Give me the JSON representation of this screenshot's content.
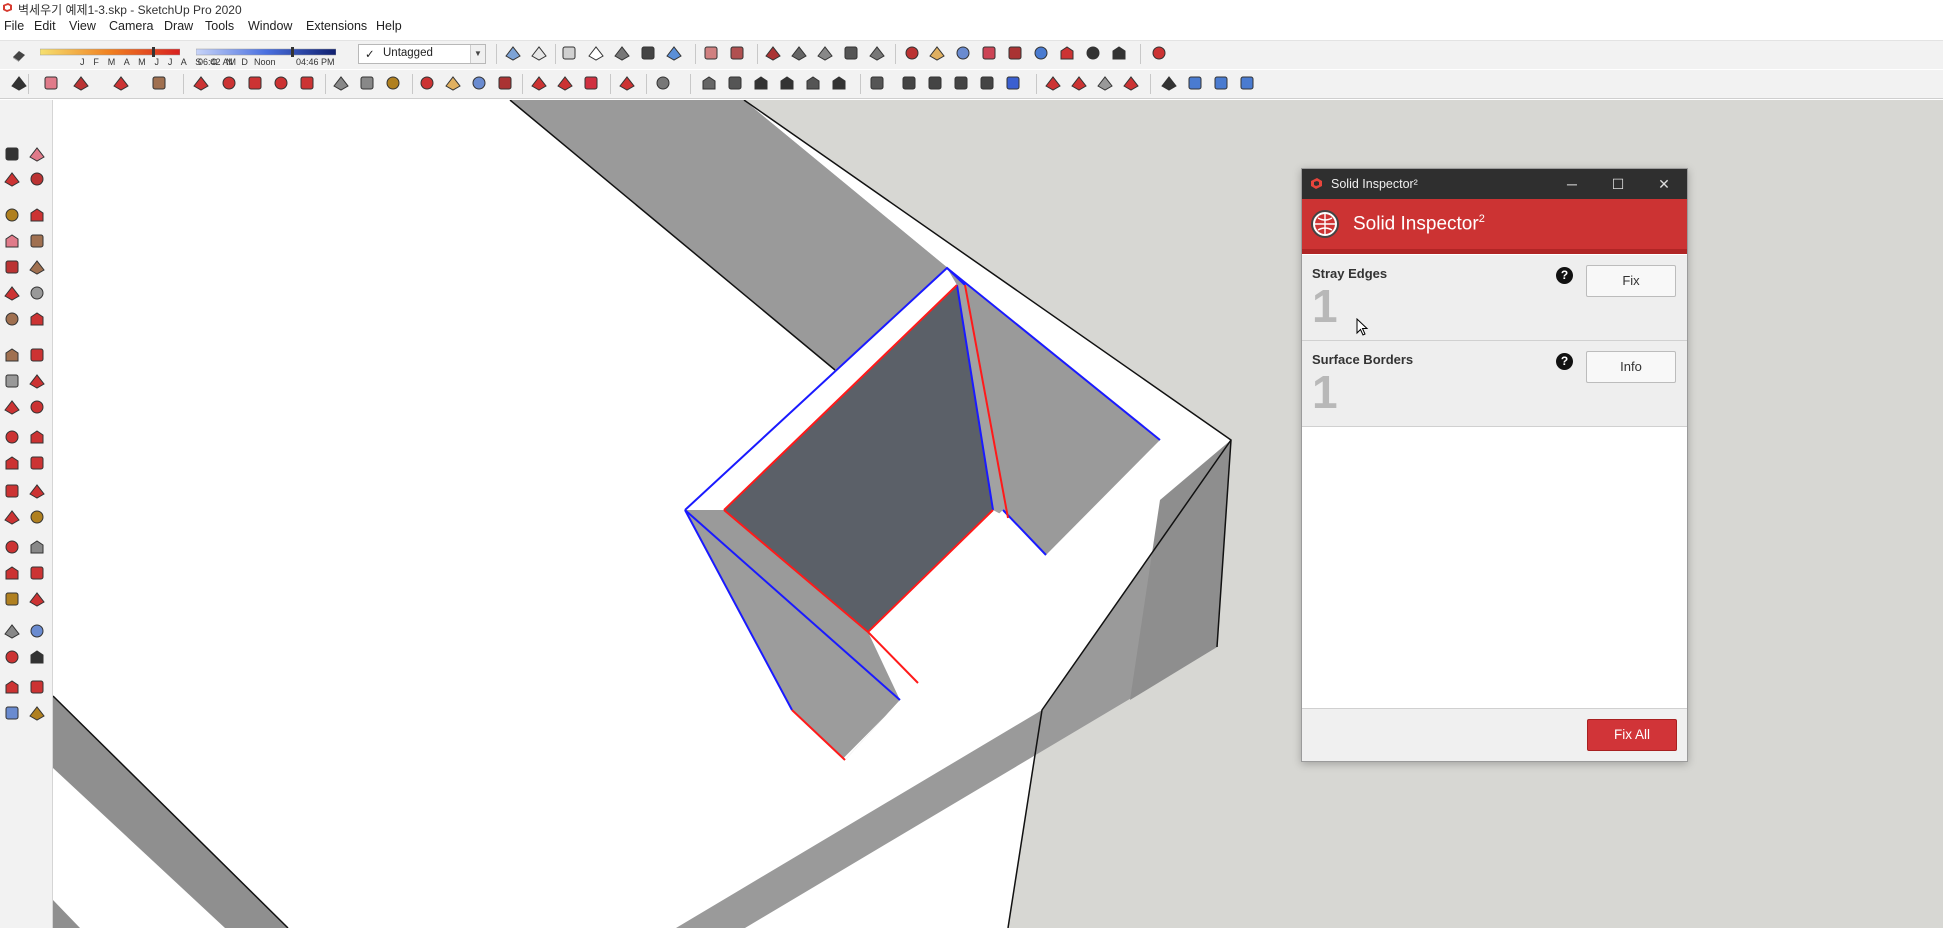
{
  "window": {
    "title": "벽세우기 예제1-3.skp - SketchUp Pro 2020"
  },
  "menubar": {
    "items": [
      "File",
      "Edit",
      "View",
      "Camera",
      "Draw",
      "Tools",
      "Window",
      "Extensions",
      "Help"
    ]
  },
  "shadow_settings": {
    "months": "J F M A M J J A S O N D",
    "time_start": "06:42 AM",
    "time_mid": "Noon",
    "time_end": "04:46 PM"
  },
  "tag_selector": {
    "value": "Untagged",
    "check": "✓"
  },
  "solid_inspector": {
    "window_title": "Solid Inspector²",
    "header_title": "Solid Inspector",
    "header_superscript": "2",
    "sections": [
      {
        "title": "Stray Edges",
        "count": "1",
        "help": "?",
        "button": "Fix"
      },
      {
        "title": "Surface Borders",
        "count": "1",
        "help": "?",
        "button": "Info"
      }
    ],
    "footer_button": "Fix All"
  },
  "colors": {
    "accent_red": "#cc3333",
    "fix_all_red": "#d13438",
    "titlebar_dark": "#2f2f2f",
    "edge_blue": "#1a1aff",
    "edge_red": "#ff1a1a"
  }
}
